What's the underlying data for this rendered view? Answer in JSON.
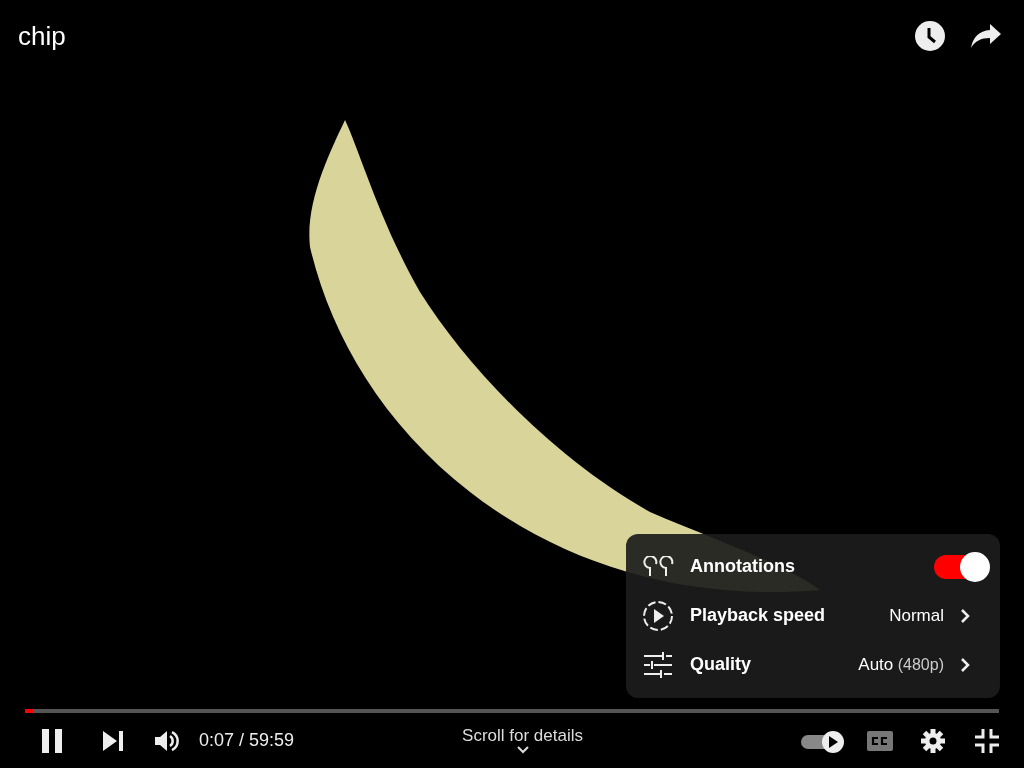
{
  "title": "chip",
  "settings_menu": [
    {
      "kind": "toggle",
      "label": "Annotations",
      "on": true
    },
    {
      "kind": "submenu",
      "label": "Playback speed",
      "value": "Normal"
    },
    {
      "kind": "submenu",
      "label": "Quality",
      "value": "Auto",
      "detail": "(480p)"
    }
  ],
  "progress": {
    "level": 0.008
  },
  "time": "0:07 / 59:59",
  "scroll_hint": "Scroll for details",
  "autoplay": {
    "on": true
  },
  "captions": {
    "disabled": true
  }
}
